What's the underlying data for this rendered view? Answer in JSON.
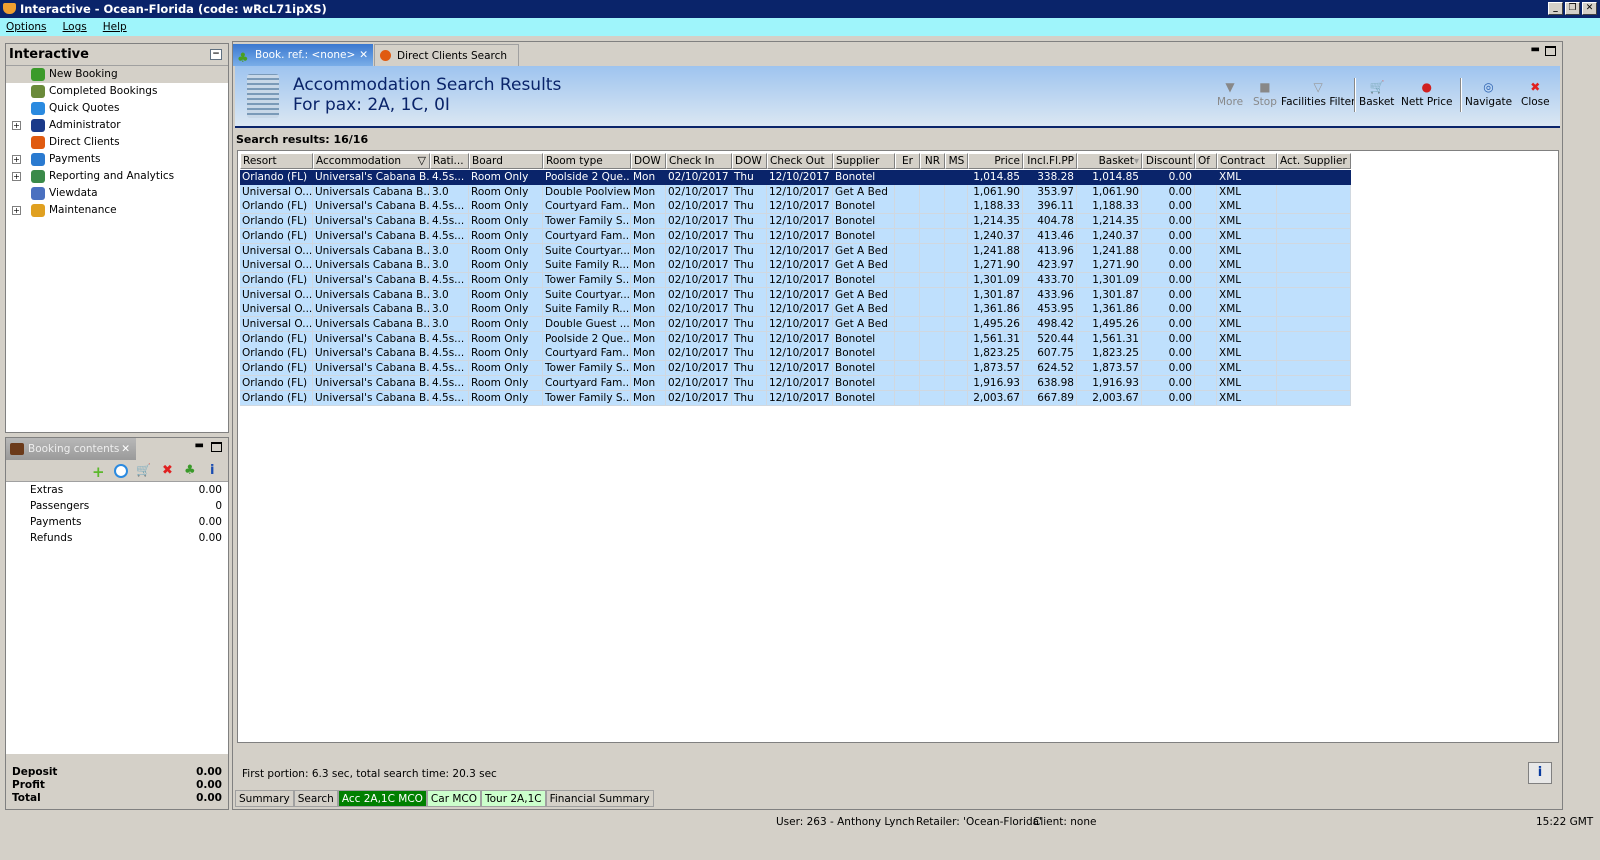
{
  "window": {
    "title": "Interactive - Ocean-Florida (code: wRcL71ipXS)"
  },
  "menu": [
    "Options",
    "Logs",
    "Help"
  ],
  "nav": {
    "title": "Interactive",
    "items": [
      {
        "label": "New Booking",
        "expandable": false,
        "icon": "palm-tree-icon"
      },
      {
        "label": "Completed Bookings",
        "expandable": false,
        "icon": "palm-money-icon"
      },
      {
        "label": "Quick Quotes",
        "expandable": false,
        "icon": "clock-icon"
      },
      {
        "label": "Administrator",
        "expandable": true,
        "icon": "runner-icon"
      },
      {
        "label": "Direct Clients",
        "expandable": false,
        "icon": "client-icon"
      },
      {
        "label": "Payments",
        "expandable": true,
        "icon": "payment-card-icon"
      },
      {
        "label": "Reporting and Analytics",
        "expandable": true,
        "icon": "report-icon"
      },
      {
        "label": "Viewdata",
        "expandable": false,
        "icon": "globe-icon"
      },
      {
        "label": "Maintenance",
        "expandable": true,
        "icon": "toolbox-icon"
      }
    ]
  },
  "booking_contents": {
    "tab": "Booking contents",
    "rows": [
      {
        "label": "Extras",
        "value": "0.00"
      },
      {
        "label": "Passengers",
        "value": "0"
      },
      {
        "label": "Payments",
        "value": "0.00"
      },
      {
        "label": "Refunds",
        "value": "0.00"
      }
    ],
    "footer": [
      {
        "label": "Deposit",
        "value": "0.00"
      },
      {
        "label": "Profit",
        "value": "0.00"
      },
      {
        "label": "Total",
        "value": "0.00"
      }
    ]
  },
  "tabs": [
    {
      "label": "Book. ref.: <none>",
      "active": true
    },
    {
      "label": "Direct Clients Search",
      "active": false
    }
  ],
  "banner": {
    "title": "Accommodation Search Results",
    "subtitle": "For pax: 2A, 1C, 0I"
  },
  "toolbar": [
    {
      "label": "More",
      "enabled": false,
      "icon": "triangle-down-icon"
    },
    {
      "label": "Stop",
      "enabled": false,
      "icon": "stop-icon"
    },
    {
      "label": "Facilities Filter",
      "enabled": true,
      "icon": "funnel-icon"
    },
    {
      "label": "Basket",
      "enabled": true,
      "icon": "basket-icon"
    },
    {
      "label": "Nett Price",
      "enabled": true,
      "icon": "price-icon"
    },
    {
      "label": "Navigate",
      "enabled": true,
      "icon": "compass-icon"
    },
    {
      "label": "Close",
      "enabled": true,
      "icon": "close-icon"
    }
  ],
  "results": {
    "count_label": "Search results: 16/16",
    "columns": [
      "Resort",
      "Accommodation",
      "Rati...",
      "Board",
      "Room type",
      "DOW",
      "Check In",
      "DOW",
      "Check Out",
      "Supplier",
      "Er",
      "NR",
      "MS",
      "Price",
      "Incl.Fl.PP",
      "Basket",
      "Discount",
      "Of",
      "Contract",
      "Act. Supplier"
    ],
    "rows": [
      [
        "Orlando (FL)",
        "Universal's Cabana B...",
        "4.5s...",
        "Room Only",
        "Poolside 2 Que...",
        "Mon",
        "02/10/2017",
        "Thu",
        "12/10/2017",
        "Bonotel",
        "",
        "",
        "",
        "1,014.85",
        "338.28",
        "1,014.85",
        "0.00",
        "",
        "XML",
        ""
      ],
      [
        "Universal O...",
        "Universals Cabana B...",
        "3.0",
        "Room Only",
        "Double Poolview",
        "Mon",
        "02/10/2017",
        "Thu",
        "12/10/2017",
        "Get A Bed",
        "",
        "",
        "",
        "1,061.90",
        "353.97",
        "1,061.90",
        "0.00",
        "",
        "XML",
        ""
      ],
      [
        "Orlando (FL)",
        "Universal's Cabana B...",
        "4.5s...",
        "Room Only",
        "Courtyard Fam...",
        "Mon",
        "02/10/2017",
        "Thu",
        "12/10/2017",
        "Bonotel",
        "",
        "",
        "",
        "1,188.33",
        "396.11",
        "1,188.33",
        "0.00",
        "",
        "XML",
        ""
      ],
      [
        "Orlando (FL)",
        "Universal's Cabana B...",
        "4.5s...",
        "Room Only",
        "Tower Family S...",
        "Mon",
        "02/10/2017",
        "Thu",
        "12/10/2017",
        "Bonotel",
        "",
        "",
        "",
        "1,214.35",
        "404.78",
        "1,214.35",
        "0.00",
        "",
        "XML",
        ""
      ],
      [
        "Orlando (FL)",
        "Universal's Cabana B...",
        "4.5s...",
        "Room Only",
        "Courtyard Fam...",
        "Mon",
        "02/10/2017",
        "Thu",
        "12/10/2017",
        "Bonotel",
        "",
        "",
        "",
        "1,240.37",
        "413.46",
        "1,240.37",
        "0.00",
        "",
        "XML",
        ""
      ],
      [
        "Universal O...",
        "Universals Cabana B...",
        "3.0",
        "Room Only",
        "Suite Courtyar...",
        "Mon",
        "02/10/2017",
        "Thu",
        "12/10/2017",
        "Get A Bed",
        "",
        "",
        "",
        "1,241.88",
        "413.96",
        "1,241.88",
        "0.00",
        "",
        "XML",
        ""
      ],
      [
        "Universal O...",
        "Universals Cabana B...",
        "3.0",
        "Room Only",
        "Suite Family R...",
        "Mon",
        "02/10/2017",
        "Thu",
        "12/10/2017",
        "Get A Bed",
        "",
        "",
        "",
        "1,271.90",
        "423.97",
        "1,271.90",
        "0.00",
        "",
        "XML",
        ""
      ],
      [
        "Orlando (FL)",
        "Universal's Cabana B...",
        "4.5s...",
        "Room Only",
        "Tower Family S...",
        "Mon",
        "02/10/2017",
        "Thu",
        "12/10/2017",
        "Bonotel",
        "",
        "",
        "",
        "1,301.09",
        "433.70",
        "1,301.09",
        "0.00",
        "",
        "XML",
        ""
      ],
      [
        "Universal O...",
        "Universals Cabana B...",
        "3.0",
        "Room Only",
        "Suite Courtyar...",
        "Mon",
        "02/10/2017",
        "Thu",
        "12/10/2017",
        "Get A Bed",
        "",
        "",
        "",
        "1,301.87",
        "433.96",
        "1,301.87",
        "0.00",
        "",
        "XML",
        ""
      ],
      [
        "Universal O...",
        "Universals Cabana B...",
        "3.0",
        "Room Only",
        "Suite Family R...",
        "Mon",
        "02/10/2017",
        "Thu",
        "12/10/2017",
        "Get A Bed",
        "",
        "",
        "",
        "1,361.86",
        "453.95",
        "1,361.86",
        "0.00",
        "",
        "XML",
        ""
      ],
      [
        "Universal O...",
        "Universals Cabana B...",
        "3.0",
        "Room Only",
        "Double Guest ...",
        "Mon",
        "02/10/2017",
        "Thu",
        "12/10/2017",
        "Get A Bed",
        "",
        "",
        "",
        "1,495.26",
        "498.42",
        "1,495.26",
        "0.00",
        "",
        "XML",
        ""
      ],
      [
        "Orlando (FL)",
        "Universal's Cabana B...",
        "4.5s...",
        "Room Only",
        "Poolside 2 Que...",
        "Mon",
        "02/10/2017",
        "Thu",
        "12/10/2017",
        "Bonotel",
        "",
        "",
        "",
        "1,561.31",
        "520.44",
        "1,561.31",
        "0.00",
        "",
        "XML",
        ""
      ],
      [
        "Orlando (FL)",
        "Universal's Cabana B...",
        "4.5s...",
        "Room Only",
        "Courtyard Fam...",
        "Mon",
        "02/10/2017",
        "Thu",
        "12/10/2017",
        "Bonotel",
        "",
        "",
        "",
        "1,823.25",
        "607.75",
        "1,823.25",
        "0.00",
        "",
        "XML",
        ""
      ],
      [
        "Orlando (FL)",
        "Universal's Cabana B...",
        "4.5s...",
        "Room Only",
        "Tower Family S...",
        "Mon",
        "02/10/2017",
        "Thu",
        "12/10/2017",
        "Bonotel",
        "",
        "",
        "",
        "1,873.57",
        "624.52",
        "1,873.57",
        "0.00",
        "",
        "XML",
        ""
      ],
      [
        "Orlando (FL)",
        "Universal's Cabana B...",
        "4.5s...",
        "Room Only",
        "Courtyard Fam...",
        "Mon",
        "02/10/2017",
        "Thu",
        "12/10/2017",
        "Bonotel",
        "",
        "",
        "",
        "1,916.93",
        "638.98",
        "1,916.93",
        "0.00",
        "",
        "XML",
        ""
      ],
      [
        "Orlando (FL)",
        "Universal's Cabana B...",
        "4.5s...",
        "Room Only",
        "Tower Family S...",
        "Mon",
        "02/10/2017",
        "Thu",
        "12/10/2017",
        "Bonotel",
        "",
        "",
        "",
        "2,003.67",
        "667.89",
        "2,003.67",
        "0.00",
        "",
        "XML",
        ""
      ]
    ],
    "selected_row": 0
  },
  "timing": "First portion: 6.3 sec, total search time: 20.3 sec",
  "bottom_tabs": [
    {
      "label": "Summary",
      "color": "#d4d0c8",
      "text": "#000"
    },
    {
      "label": "Search",
      "color": "#d4d0c8",
      "text": "#000"
    },
    {
      "label": "Acc 2A,1C MCO",
      "color": "#008000",
      "text": "#fff"
    },
    {
      "label": "Car MCO",
      "color": "#ccffcc",
      "text": "#000"
    },
    {
      "label": "Tour 2A,1C",
      "color": "#ccffcc",
      "text": "#000"
    },
    {
      "label": "Financial Summary",
      "color": "#d4d0c8",
      "text": "#000"
    }
  ],
  "status": {
    "user": "User: 263 - Anthony Lynch",
    "retailer": "Retailer: 'Ocean-Florida'",
    "client": "Client: none",
    "time": "15:22 GMT"
  }
}
